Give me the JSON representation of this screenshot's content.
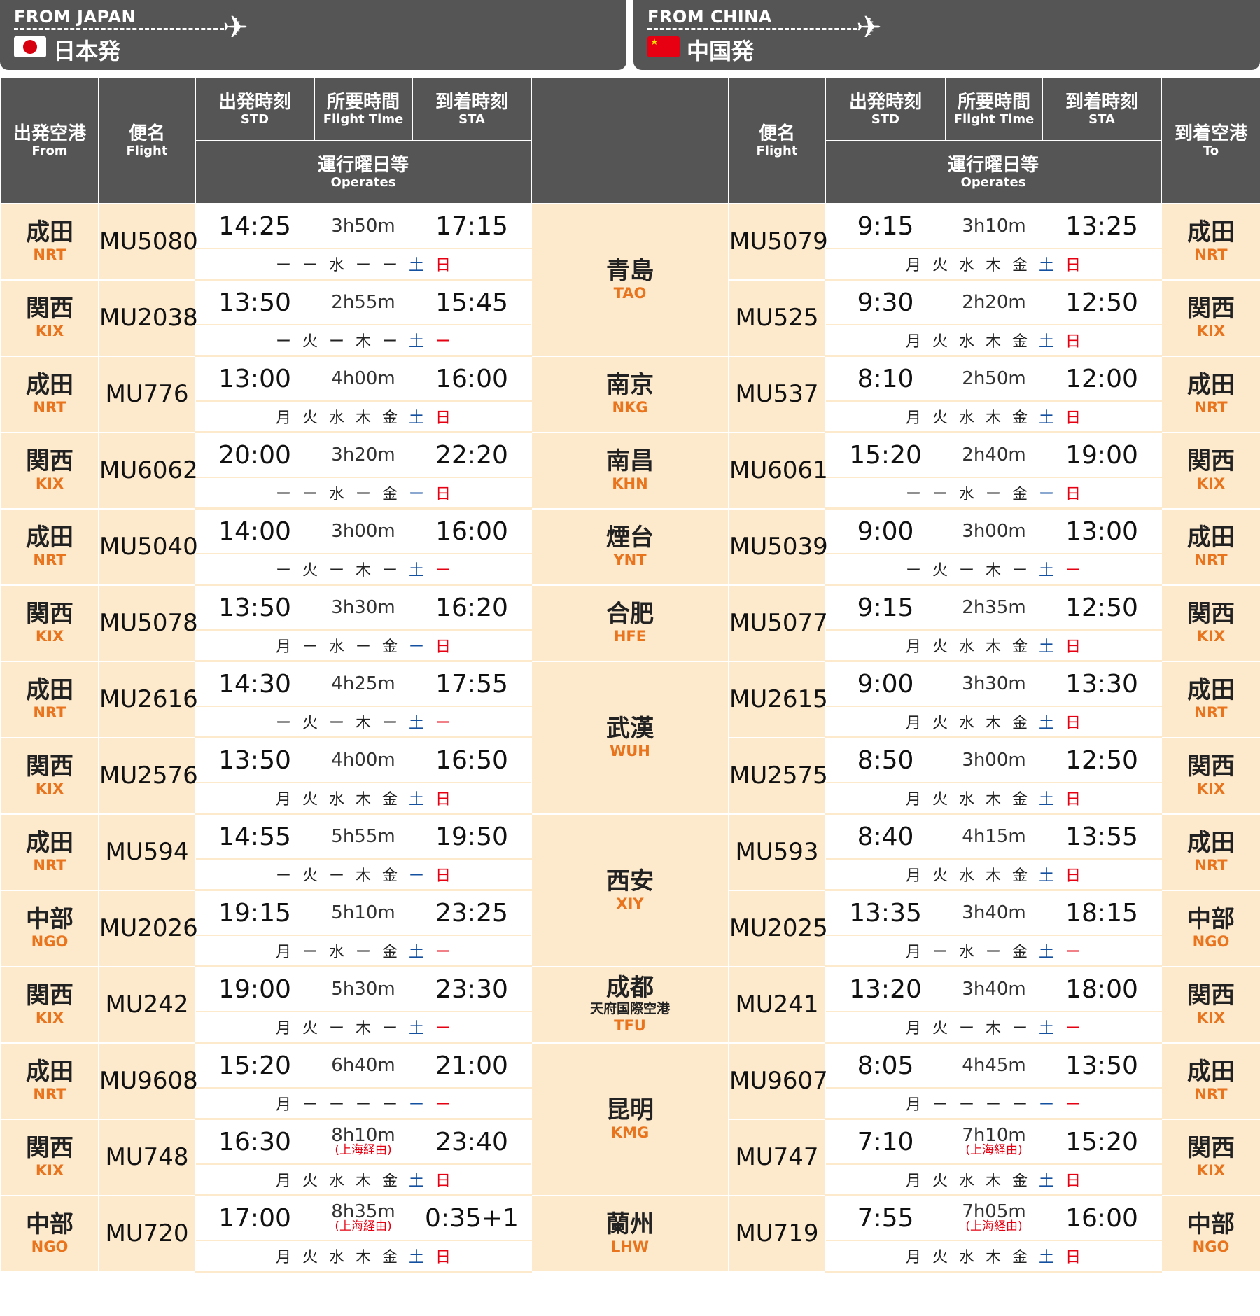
{
  "banners": [
    {
      "en": "FROM JAPAN",
      "jp": "日本発",
      "flag": "japan-flag"
    },
    {
      "en": "FROM CHINA",
      "jp": "中国発",
      "flag": "china-flag"
    }
  ],
  "header": {
    "from_jp": "出発空港",
    "from_en": "From",
    "flight_jp": "便名",
    "flight_en": "Flight",
    "std_jp": "出発時刻",
    "std_en": "STD",
    "ft_jp": "所要時間",
    "ft_en": "Flight Time",
    "sta_jp": "到着時刻",
    "sta_en": "STA",
    "ops_jp": "運行曜日等",
    "ops_en": "Operates",
    "to_jp": "到着空港",
    "to_en": "To"
  },
  "colors": {
    "header_bg": "#555555",
    "cell_bg": "#fde9cc",
    "code": "#e8741e",
    "saturday": "#1450a0",
    "sunday": "#e60012"
  },
  "rows": [
    {
      "ja_ap": "成田",
      "ja_code": "NRT",
      "out_fl": "MU5080",
      "out_std": "14:25",
      "out_dur": "3h50m",
      "out_via": "",
      "out_sta": "17:15",
      "out_ops": [
        "ー",
        "ー",
        "水",
        "ー",
        "ー",
        "土",
        "日"
      ],
      "in_fl": "MU5079",
      "in_std": "9:15",
      "in_dur": "3h10m",
      "in_via": "",
      "in_sta": "13:25",
      "in_ops": [
        "月",
        "火",
        "水",
        "木",
        "金",
        "土",
        "日"
      ]
    },
    {
      "ja_ap": "関西",
      "ja_code": "KIX",
      "out_fl": "MU2038",
      "out_std": "13:50",
      "out_dur": "2h55m",
      "out_via": "",
      "out_sta": "15:45",
      "out_ops": [
        "ー",
        "火",
        "ー",
        "木",
        "ー",
        "土",
        "ー"
      ],
      "in_fl": "MU525",
      "in_std": "9:30",
      "in_dur": "2h20m",
      "in_via": "",
      "in_sta": "12:50",
      "in_ops": [
        "月",
        "火",
        "水",
        "木",
        "金",
        "土",
        "日"
      ]
    },
    {
      "ja_ap": "成田",
      "ja_code": "NRT",
      "out_fl": "MU776",
      "out_std": "13:00",
      "out_dur": "4h00m",
      "out_via": "",
      "out_sta": "16:00",
      "out_ops": [
        "月",
        "火",
        "水",
        "木",
        "金",
        "土",
        "日"
      ],
      "in_fl": "MU537",
      "in_std": "8:10",
      "in_dur": "2h50m",
      "in_via": "",
      "in_sta": "12:00",
      "in_ops": [
        "月",
        "火",
        "水",
        "木",
        "金",
        "土",
        "日"
      ]
    },
    {
      "ja_ap": "関西",
      "ja_code": "KIX",
      "out_fl": "MU6062",
      "out_std": "20:00",
      "out_dur": "3h20m",
      "out_via": "",
      "out_sta": "22:20",
      "out_ops": [
        "ー",
        "ー",
        "水",
        "ー",
        "金",
        "ー",
        "日"
      ],
      "in_fl": "MU6061",
      "in_std": "15:20",
      "in_dur": "2h40m",
      "in_via": "",
      "in_sta": "19:00",
      "in_ops": [
        "ー",
        "ー",
        "水",
        "ー",
        "金",
        "ー",
        "日"
      ]
    },
    {
      "ja_ap": "成田",
      "ja_code": "NRT",
      "out_fl": "MU5040",
      "out_std": "14:00",
      "out_dur": "3h00m",
      "out_via": "",
      "out_sta": "16:00",
      "out_ops": [
        "ー",
        "火",
        "ー",
        "木",
        "ー",
        "土",
        "ー"
      ],
      "in_fl": "MU5039",
      "in_std": "9:00",
      "in_dur": "3h00m",
      "in_via": "",
      "in_sta": "13:00",
      "in_ops": [
        "ー",
        "火",
        "ー",
        "木",
        "ー",
        "土",
        "ー"
      ]
    },
    {
      "ja_ap": "関西",
      "ja_code": "KIX",
      "out_fl": "MU5078",
      "out_std": "13:50",
      "out_dur": "3h30m",
      "out_via": "",
      "out_sta": "16:20",
      "out_ops": [
        "月",
        "ー",
        "水",
        "ー",
        "金",
        "ー",
        "日"
      ],
      "in_fl": "MU5077",
      "in_std": "9:15",
      "in_dur": "2h35m",
      "in_via": "",
      "in_sta": "12:50",
      "in_ops": [
        "月",
        "火",
        "水",
        "木",
        "金",
        "土",
        "日"
      ]
    },
    {
      "ja_ap": "成田",
      "ja_code": "NRT",
      "out_fl": "MU2616",
      "out_std": "14:30",
      "out_dur": "4h25m",
      "out_via": "",
      "out_sta": "17:55",
      "out_ops": [
        "ー",
        "火",
        "ー",
        "木",
        "ー",
        "土",
        "ー"
      ],
      "in_fl": "MU2615",
      "in_std": "9:00",
      "in_dur": "3h30m",
      "in_via": "",
      "in_sta": "13:30",
      "in_ops": [
        "月",
        "火",
        "水",
        "木",
        "金",
        "土",
        "日"
      ]
    },
    {
      "ja_ap": "関西",
      "ja_code": "KIX",
      "out_fl": "MU2576",
      "out_std": "13:50",
      "out_dur": "4h00m",
      "out_via": "",
      "out_sta": "16:50",
      "out_ops": [
        "月",
        "火",
        "水",
        "木",
        "金",
        "土",
        "日"
      ],
      "in_fl": "MU2575",
      "in_std": "8:50",
      "in_dur": "3h00m",
      "in_via": "",
      "in_sta": "12:50",
      "in_ops": [
        "月",
        "火",
        "水",
        "木",
        "金",
        "土",
        "日"
      ]
    },
    {
      "ja_ap": "成田",
      "ja_code": "NRT",
      "out_fl": "MU594",
      "out_std": "14:55",
      "out_dur": "5h55m",
      "out_via": "",
      "out_sta": "19:50",
      "out_ops": [
        "ー",
        "火",
        "ー",
        "木",
        "金",
        "ー",
        "日"
      ],
      "in_fl": "MU593",
      "in_std": "8:40",
      "in_dur": "4h15m",
      "in_via": "",
      "in_sta": "13:55",
      "in_ops": [
        "月",
        "火",
        "水",
        "木",
        "金",
        "土",
        "日"
      ]
    },
    {
      "ja_ap": "中部",
      "ja_code": "NGO",
      "out_fl": "MU2026",
      "out_std": "19:15",
      "out_dur": "5h10m",
      "out_via": "",
      "out_sta": "23:25",
      "out_ops": [
        "月",
        "ー",
        "水",
        "ー",
        "金",
        "土",
        "ー"
      ],
      "in_fl": "MU2025",
      "in_std": "13:35",
      "in_dur": "3h40m",
      "in_via": "",
      "in_sta": "18:15",
      "in_ops": [
        "月",
        "ー",
        "水",
        "ー",
        "金",
        "土",
        "ー"
      ]
    },
    {
      "ja_ap": "関西",
      "ja_code": "KIX",
      "out_fl": "MU242",
      "out_std": "19:00",
      "out_dur": "5h30m",
      "out_via": "",
      "out_sta": "23:30",
      "out_ops": [
        "月",
        "火",
        "ー",
        "木",
        "ー",
        "土",
        "ー"
      ],
      "in_fl": "MU241",
      "in_std": "13:20",
      "in_dur": "3h40m",
      "in_via": "",
      "in_sta": "18:00",
      "in_ops": [
        "月",
        "火",
        "ー",
        "木",
        "ー",
        "土",
        "ー"
      ]
    },
    {
      "ja_ap": "成田",
      "ja_code": "NRT",
      "out_fl": "MU9608",
      "out_std": "15:20",
      "out_dur": "6h40m",
      "out_via": "",
      "out_sta": "21:00",
      "out_ops": [
        "月",
        "ー",
        "ー",
        "ー",
        "ー",
        "ー",
        "ー"
      ],
      "in_fl": "MU9607",
      "in_std": "8:05",
      "in_dur": "4h45m",
      "in_via": "",
      "in_sta": "13:50",
      "in_ops": [
        "月",
        "ー",
        "ー",
        "ー",
        "ー",
        "ー",
        "ー"
      ]
    },
    {
      "ja_ap": "関西",
      "ja_code": "KIX",
      "out_fl": "MU748",
      "out_std": "16:30",
      "out_dur": "8h10m",
      "out_via": "(上海経由)",
      "out_sta": "23:40",
      "out_ops": [
        "月",
        "火",
        "水",
        "木",
        "金",
        "土",
        "日"
      ],
      "in_fl": "MU747",
      "in_std": "7:10",
      "in_dur": "7h10m",
      "in_via": "(上海経由)",
      "in_sta": "15:20",
      "in_ops": [
        "月",
        "火",
        "水",
        "木",
        "金",
        "土",
        "日"
      ]
    },
    {
      "ja_ap": "中部",
      "ja_code": "NGO",
      "out_fl": "MU720",
      "out_std": "17:00",
      "out_dur": "8h35m",
      "out_via": "(上海経由)",
      "out_sta": "0:35+1",
      "out_ops": [
        "月",
        "火",
        "水",
        "木",
        "金",
        "土",
        "日"
      ],
      "in_fl": "MU719",
      "in_std": "7:55",
      "in_dur": "7h05m",
      "in_via": "(上海経由)",
      "in_sta": "16:00",
      "in_ops": [
        "月",
        "火",
        "水",
        "木",
        "金",
        "土",
        "日"
      ]
    }
  ],
  "cities": [
    {
      "start": 0,
      "span": 2,
      "jp": "青島",
      "sub": "",
      "code": "TAO"
    },
    {
      "start": 2,
      "span": 1,
      "jp": "南京",
      "sub": "",
      "code": "NKG"
    },
    {
      "start": 3,
      "span": 1,
      "jp": "南昌",
      "sub": "",
      "code": "KHN"
    },
    {
      "start": 4,
      "span": 1,
      "jp": "煙台",
      "sub": "",
      "code": "YNT"
    },
    {
      "start": 5,
      "span": 1,
      "jp": "合肥",
      "sub": "",
      "code": "HFE"
    },
    {
      "start": 6,
      "span": 2,
      "jp": "武漢",
      "sub": "",
      "code": "WUH"
    },
    {
      "start": 8,
      "span": 2,
      "jp": "西安",
      "sub": "",
      "code": "XIY"
    },
    {
      "start": 10,
      "span": 1,
      "jp": "成都",
      "sub": "天府国際空港",
      "code": "TFU"
    },
    {
      "start": 11,
      "span": 2,
      "jp": "昆明",
      "sub": "",
      "code": "KMG"
    },
    {
      "start": 13,
      "span": 1,
      "jp": "蘭州",
      "sub": "",
      "code": "LHW"
    }
  ]
}
